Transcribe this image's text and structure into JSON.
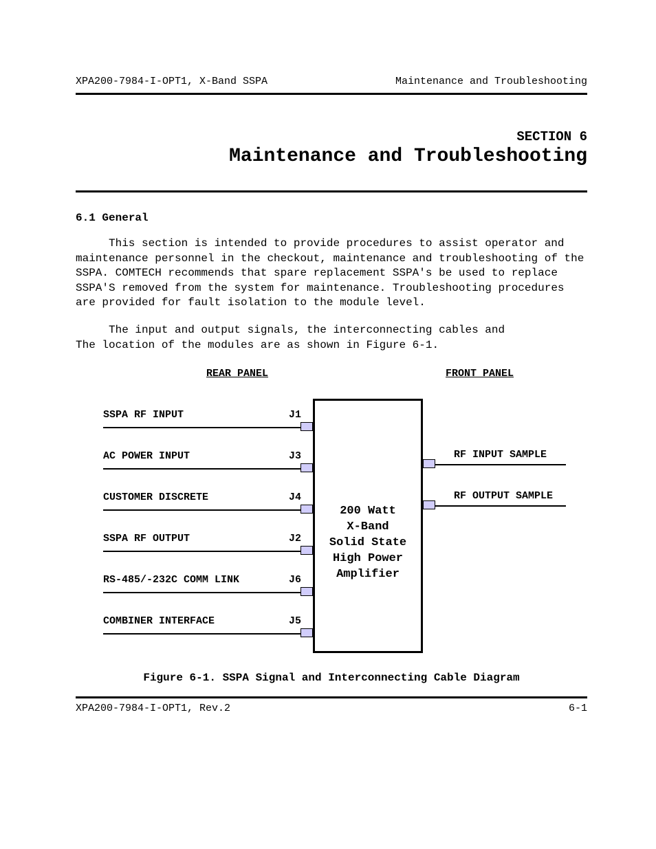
{
  "header": {
    "left": "XPA200-7984-I-OPT1, X-Band SSPA",
    "right": "Maintenance and Troubleshooting"
  },
  "section": {
    "label": "SECTION 6",
    "title": "Maintenance and Troubleshooting"
  },
  "subsection": {
    "num_title": "6.1  General"
  },
  "paragraphs": {
    "p1": "This section is intended to provide procedures to assist operator and maintenance personnel in the checkout, maintenance and troubleshooting of the SSPA.  COMTECH recommends that spare replacement SSPA's be used to replace SSPA'S removed from the system for maintenance.  Troubleshooting procedures are provided for fault isolation to the module level.",
    "p2a": "The input and output signals, the interconnecting cables and",
    "p2b": "The location of the modules are as shown in Figure 6-1."
  },
  "diagram": {
    "rear_panel": "REAR PANEL",
    "front_panel": "FRONT PANEL",
    "left_ports": [
      {
        "label": "SSPA RF INPUT",
        "conn": "J1"
      },
      {
        "label": "AC POWER INPUT",
        "conn": "J3"
      },
      {
        "label": "CUSTOMER DISCRETE",
        "conn": "J4"
      },
      {
        "label": "SSPA RF OUTPUT",
        "conn": "J2"
      },
      {
        "label": "RS-485/-232C COMM LINK",
        "conn": "J6"
      },
      {
        "label": "COMBINER INTERFACE",
        "conn": "J5"
      }
    ],
    "right_ports": [
      {
        "label": "RF INPUT SAMPLE"
      },
      {
        "label": "RF OUTPUT SAMPLE"
      }
    ],
    "box_lines": [
      "200 Watt",
      "X-Band",
      "Solid State",
      "High Power",
      "Amplifier"
    ]
  },
  "figure_caption": "Figure 6-1.  SSPA Signal and Interconnecting Cable Diagram",
  "footer": {
    "left": "XPA200-7984-I-OPT1, Rev.2",
    "right": "6-1"
  }
}
